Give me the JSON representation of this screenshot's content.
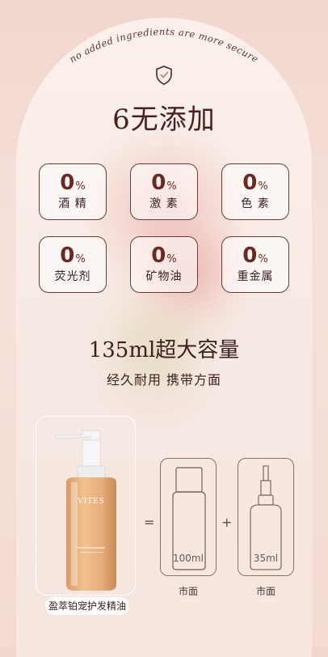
{
  "header": {
    "arc_text": "no added ingredients are more secure",
    "shield_icon": "shield-check-icon",
    "title": "6无添加"
  },
  "features": [
    {
      "value": "0",
      "unit": "%",
      "name": "酒 精"
    },
    {
      "value": "0",
      "unit": "%",
      "name": "激 素"
    },
    {
      "value": "0",
      "unit": "%",
      "name": "色 素"
    },
    {
      "value": "0",
      "unit": "%",
      "name": "荧光剂"
    },
    {
      "value": "0",
      "unit": "%",
      "name": "矿物油"
    },
    {
      "value": "0",
      "unit": "%",
      "name": "重金属"
    }
  ],
  "capacity": {
    "title": "135ml超大容量",
    "subtitle": "经久耐用  携带方面"
  },
  "comparison": {
    "product_label": "盈萃铂宠护发精油",
    "product_brand": "VITES",
    "plus_sign": "=",
    "add_sign": "+",
    "item1": {
      "volume": "100ml",
      "label": "市面"
    },
    "item2": {
      "volume": "35ml",
      "label": "市面"
    }
  },
  "colors": {
    "accent": "#6f3a36",
    "background": "#f6e1da"
  }
}
